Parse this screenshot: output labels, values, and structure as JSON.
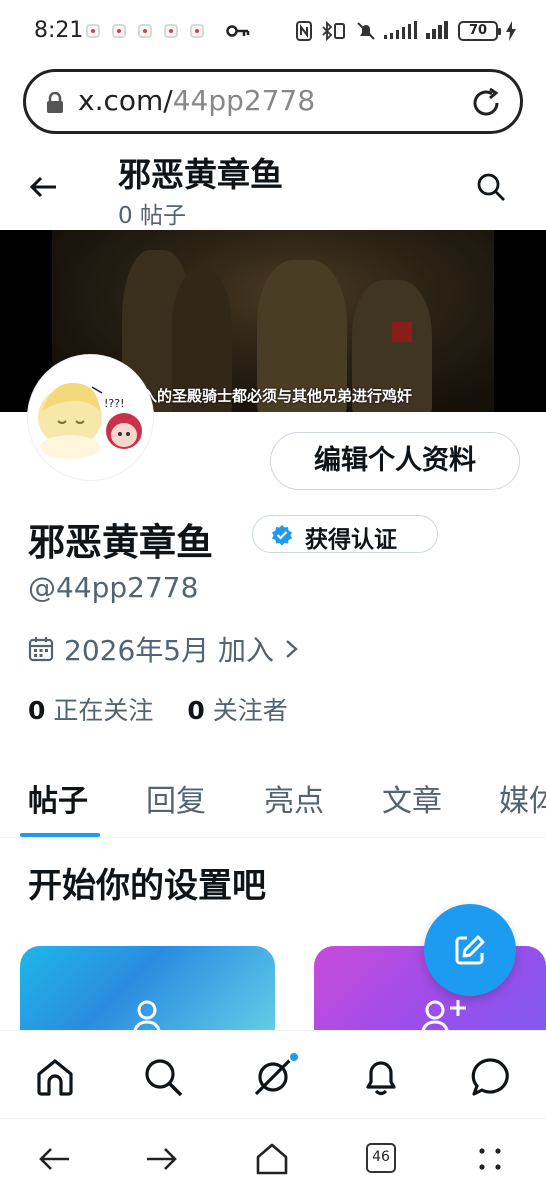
{
  "status_bar": {
    "time": "8:21",
    "battery": "70"
  },
  "url_bar": {
    "domain": "x.com/",
    "path": "44pp2778"
  },
  "header": {
    "title": "邪恶黄章鱼",
    "post_count": "0 帖子"
  },
  "banner": {
    "caption": "入的圣殿骑士都必须与其他兄弟进行鸡奸"
  },
  "profile": {
    "edit_button": "编辑个人资料",
    "name": "邪恶黄章鱼",
    "verify_label": "获得认证",
    "handle": "@44pp2778",
    "joined": "2026年5月 加入",
    "following_count": "0",
    "following_label": "正在关注",
    "followers_count": "0",
    "followers_label": "关注者"
  },
  "tabs": [
    {
      "label": "帖子",
      "active": true
    },
    {
      "label": "回复"
    },
    {
      "label": "亮点"
    },
    {
      "label": "文章"
    },
    {
      "label": "媒体"
    }
  ],
  "setup": {
    "title": "开始你的设置吧"
  },
  "browser": {
    "tab_count": "46"
  },
  "colors": {
    "accent": "#1d9bf0",
    "text": "#0f1419",
    "muted": "#536471"
  },
  "icons": [
    "key-icon",
    "lock-icon",
    "reload-icon",
    "back-arrow-icon",
    "search-icon",
    "verified-badge-icon",
    "calendar-icon",
    "chevron-right-icon",
    "compose-icon",
    "home-icon",
    "grok-icon",
    "bell-icon",
    "chat-icon"
  ]
}
